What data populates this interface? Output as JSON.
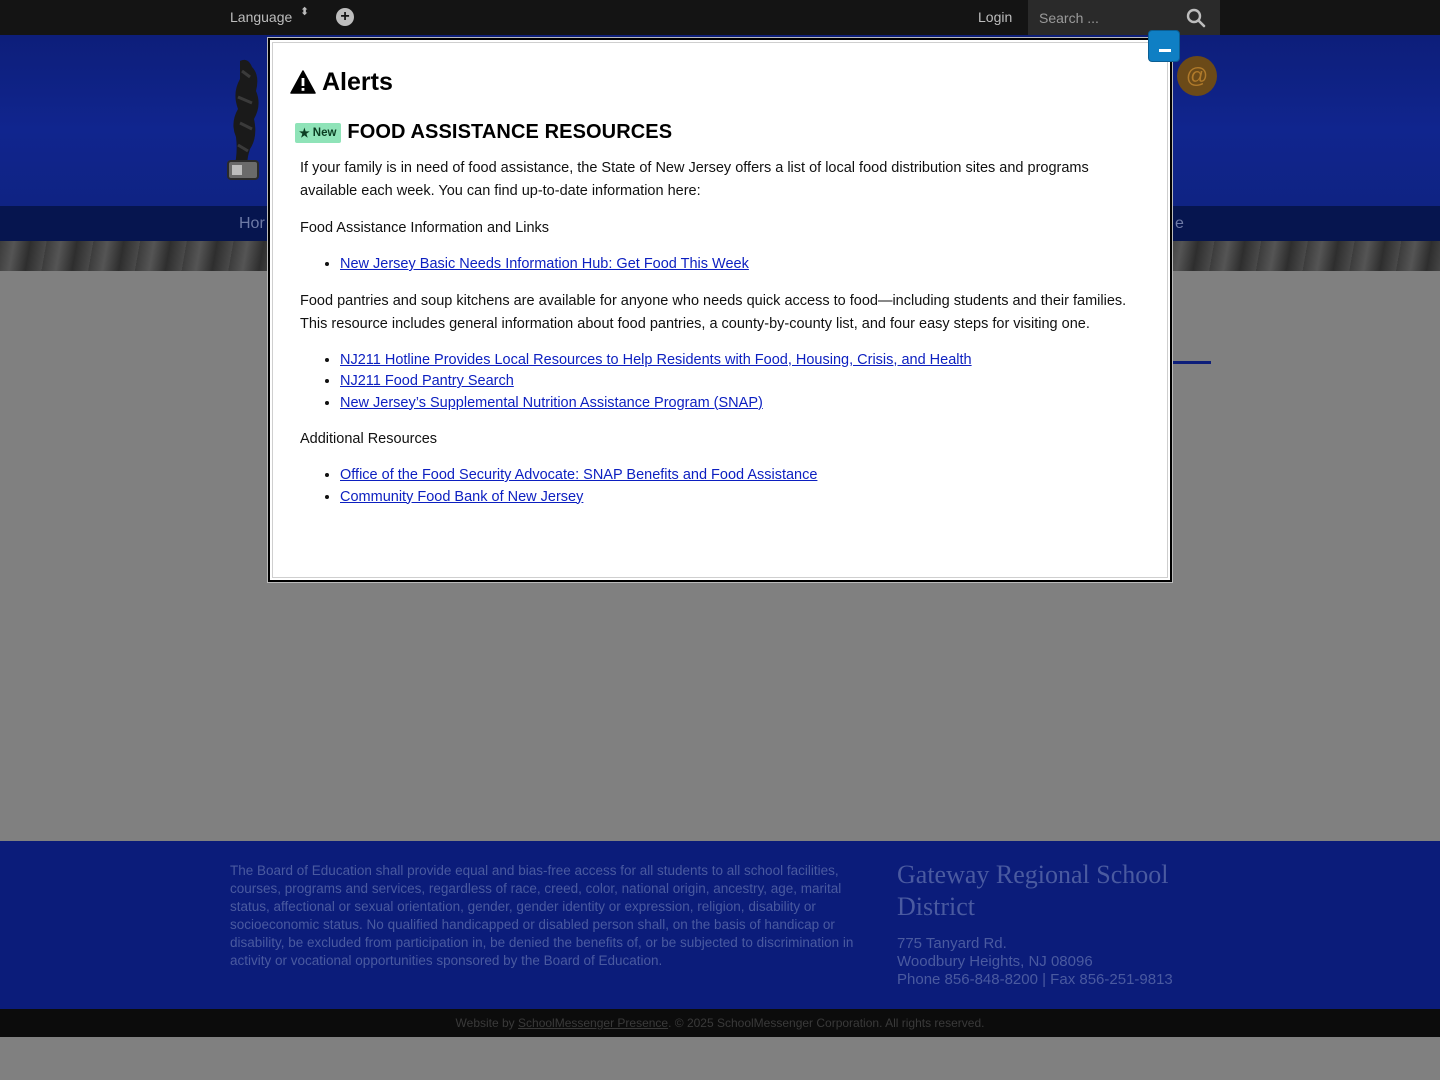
{
  "topbar": {
    "language_label": "Language",
    "language_caret": "⬍",
    "plus_glyph": "+",
    "login_label": "Login",
    "search_placeholder": "Search ..."
  },
  "header": {
    "email_glyph": "@"
  },
  "nav": {
    "first_item_partial": "Hor",
    "last_item_partial": "e"
  },
  "modal": {
    "title": "Alerts",
    "minimize_icon": "minus-icon",
    "alert": {
      "badge": "New",
      "badge_icon": "★",
      "heading": "FOOD ASSISTANCE RESOURCES",
      "intro": "If your family is in need of food assistance, the State of New Jersey offers a list of local food distribution sites and programs available each week. You can find up-to-date information here:",
      "section1_title": "Food Assistance Information and Links",
      "section1_links": [
        "New Jersey Basic Needs Information Hub: Get Food This Week"
      ],
      "pantries_text": "Food pantries and soup kitchens are available for anyone who needs quick access to food—including students and their families. This resource includes general information about food pantries, a county-by-county list, and four easy steps for visiting one.",
      "section2_links": [
        "NJ211 Hotline Provides Local Resources to Help Residents with Food, Housing, Crisis, and Health",
        "NJ211 Food Pantry Search",
        "New Jersey’s Supplemental Nutrition Assistance Program (SNAP)"
      ],
      "section3_title": "Additional Resources",
      "section3_links": [
        "Office of the Food Security Advocate: SNAP Benefits and Food Assistance",
        "Community Food Bank of New Jersey"
      ]
    }
  },
  "footer": {
    "policy": "The Board of Education shall provide equal and bias-free access for all students to all school facilities, courses, programs and services, regardless of race, creed, color, national origin, ancestry, age, marital status, affectional or sexual orientation, gender, gender identity or expression, religion, disability or socioeconomic status. No qualified handicapped or disabled person shall, on the basis of handicap or disability, be excluded from participation in, be denied the benefits of, or be subjected to discrimination in activity or vocational opportunities sponsored by the Board of Education.",
    "district_name": "Gateway Regional School District",
    "address_line1": "775 Tanyard Rd.",
    "address_line2": "Woodbury Heights, NJ 08096",
    "phone_line": "Phone 856-848-8200 | Fax 856-251-9813",
    "credits_prefix": "Website by",
    "credits_link": "SchoolMessenger Presence",
    "credits_suffix": ". © 2025 SchoolMessenger Corporation. All rights reserved."
  },
  "colors": {
    "header_blue": "#10258e",
    "footer_blue": "#0b1c7a",
    "minimize_button": "#0f7fc4",
    "badge_green": "#8fe3b8",
    "link_blue": "#0c1fc0"
  }
}
